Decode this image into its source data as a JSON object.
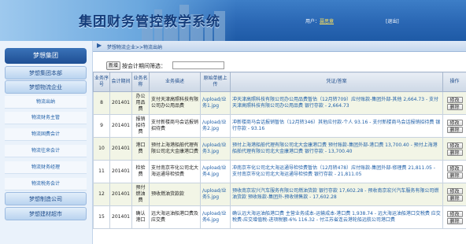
{
  "header": {
    "title": "集团财务管控教学系统",
    "user_label": "用户：",
    "user_name": "聂思章",
    "logout": "[退出]"
  },
  "breadcrumb": {
    "text": "梦想物流企业>>物流出纳"
  },
  "sidebar": {
    "top": "梦想集团",
    "items": [
      {
        "label": "梦想集团本部",
        "level": 1
      },
      {
        "label": "梦想物流企业",
        "level": 1
      },
      {
        "label": "物流出纳",
        "level": 2
      },
      {
        "label": "物流财务主管",
        "level": 2
      },
      {
        "label": "物流固费会计",
        "level": 2
      },
      {
        "label": "物流往来会计",
        "level": 2
      },
      {
        "label": "物流财务经理",
        "level": 2
      },
      {
        "label": "物流税务会计",
        "level": 2
      },
      {
        "label": "梦想制造公司",
        "level": 1
      },
      {
        "label": "梦想建材超市",
        "level": 1
      }
    ]
  },
  "toolbar": {
    "new_button": "新增",
    "filter_label": "按会计期间筛选：",
    "filter_value": ""
  },
  "table": {
    "headers": [
      "业务序号",
      "会计期间",
      "业务名称",
      "业务描述",
      "原始单据上传",
      "凭证/答案",
      "操作"
    ],
    "rows": [
      {
        "seq": "8",
        "period": "201401",
        "name": "办公用品费",
        "desc": "支付天津高照科技有限公司办公用品费",
        "upload": "/upload/业务1.jpg",
        "answer": "冲天津高照科技有限公司办公用品费暂估（12月转709）应付账款-集团外部-其他 2,664.73 - 支付天津高照科技有限公司办公用品费 银行存款 - 2,664.73",
        "op1": "修改",
        "op2": "删除"
      },
      {
        "seq": "9",
        "period": "201401",
        "name": "报销招待费",
        "desc": "支付新楼商马会话报销招待费",
        "upload": "/upload/业务2.jpg",
        "answer": "冲新楼商马会话报销暂估（12月转346）其他应付款-个人 93.16 - 支付新楼商马会话报销招待费 银行存款 - 93.16",
        "op1": "修改",
        "op2": "删除"
      },
      {
        "seq": "10",
        "period": "201401",
        "name": "港口费",
        "desc": "预付上海港船舶代理有限公司北大金康港口费",
        "upload": "/upload/业务3.jpg",
        "answer": "预付上海港船舶代理有限公司北大金康港口费 预付账款-集团外部-港口费 13,700.40 - 预付上海港船舶代理有限公司北大金康港口费 银行存款 - 13,700.40",
        "op1": "修改",
        "op2": "删除"
      },
      {
        "seq": "11",
        "period": "201401",
        "name": "检验费",
        "desc": "支付南京市化公司北大海运通导检验费",
        "upload": "/upload/业务4.jpg",
        "answer": "冲南京市化公司北大海运通导检验费暂估（12月转478）应付账款-集团外部-修理费 21,811.05 - 支付南京市化公司北大海运通导检验费 银行存款 - 21,811.05",
        "op1": "修改",
        "op2": "删除"
      },
      {
        "seq": "12",
        "period": "201401",
        "name": "预付燃油费",
        "desc": "预收燃油货款款",
        "upload": "/upload/业务5.jpg",
        "answer": "预收南京宏兴汽车服务有限公司燃油货款 银行存款 17,602.28 - 预收南京宏兴汽车服务有限公司燃油货款 预收账款-集团外-预收销售款 - 17,602.28",
        "op1": "修改",
        "op2": "删除"
      },
      {
        "seq": "15",
        "period": "201401",
        "name": "确认港口",
        "desc": "远大海运油船港口费及应交费",
        "upload": "/upload/业务6.jpg",
        "answer": "确认远大海运油船港口费 主营业务成本-运输成本-港口费 1,938.74 - 远大海运油船港口交税费 应交税费-应交增值税-进项税额-6% 116.32 - 付江苏省连云港轮船远航公司港口费",
        "op1": "修改",
        "op2": "删除"
      }
    ]
  }
}
